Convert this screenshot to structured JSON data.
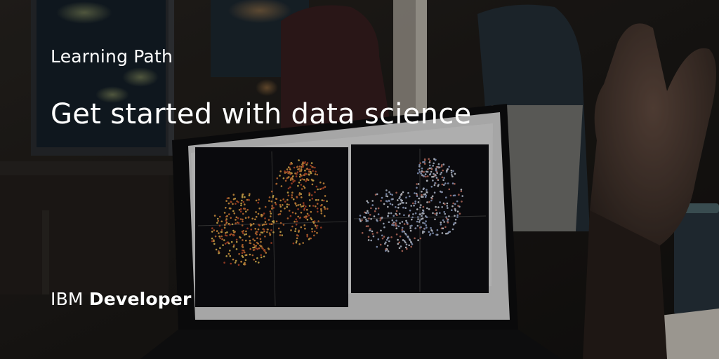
{
  "eyebrow": "Learning Path",
  "headline": "Get started with data science",
  "brand": {
    "prefix": "IBM",
    "name": "Developer"
  },
  "colors": {
    "text": "#ffffff",
    "background_dark": "#1b1917",
    "laptop_screen": "#e7e7e7",
    "plot_bg": "#0f0f12",
    "plot_warm_points": "#f0a848",
    "plot_cool_points": "#c8d4ec"
  }
}
